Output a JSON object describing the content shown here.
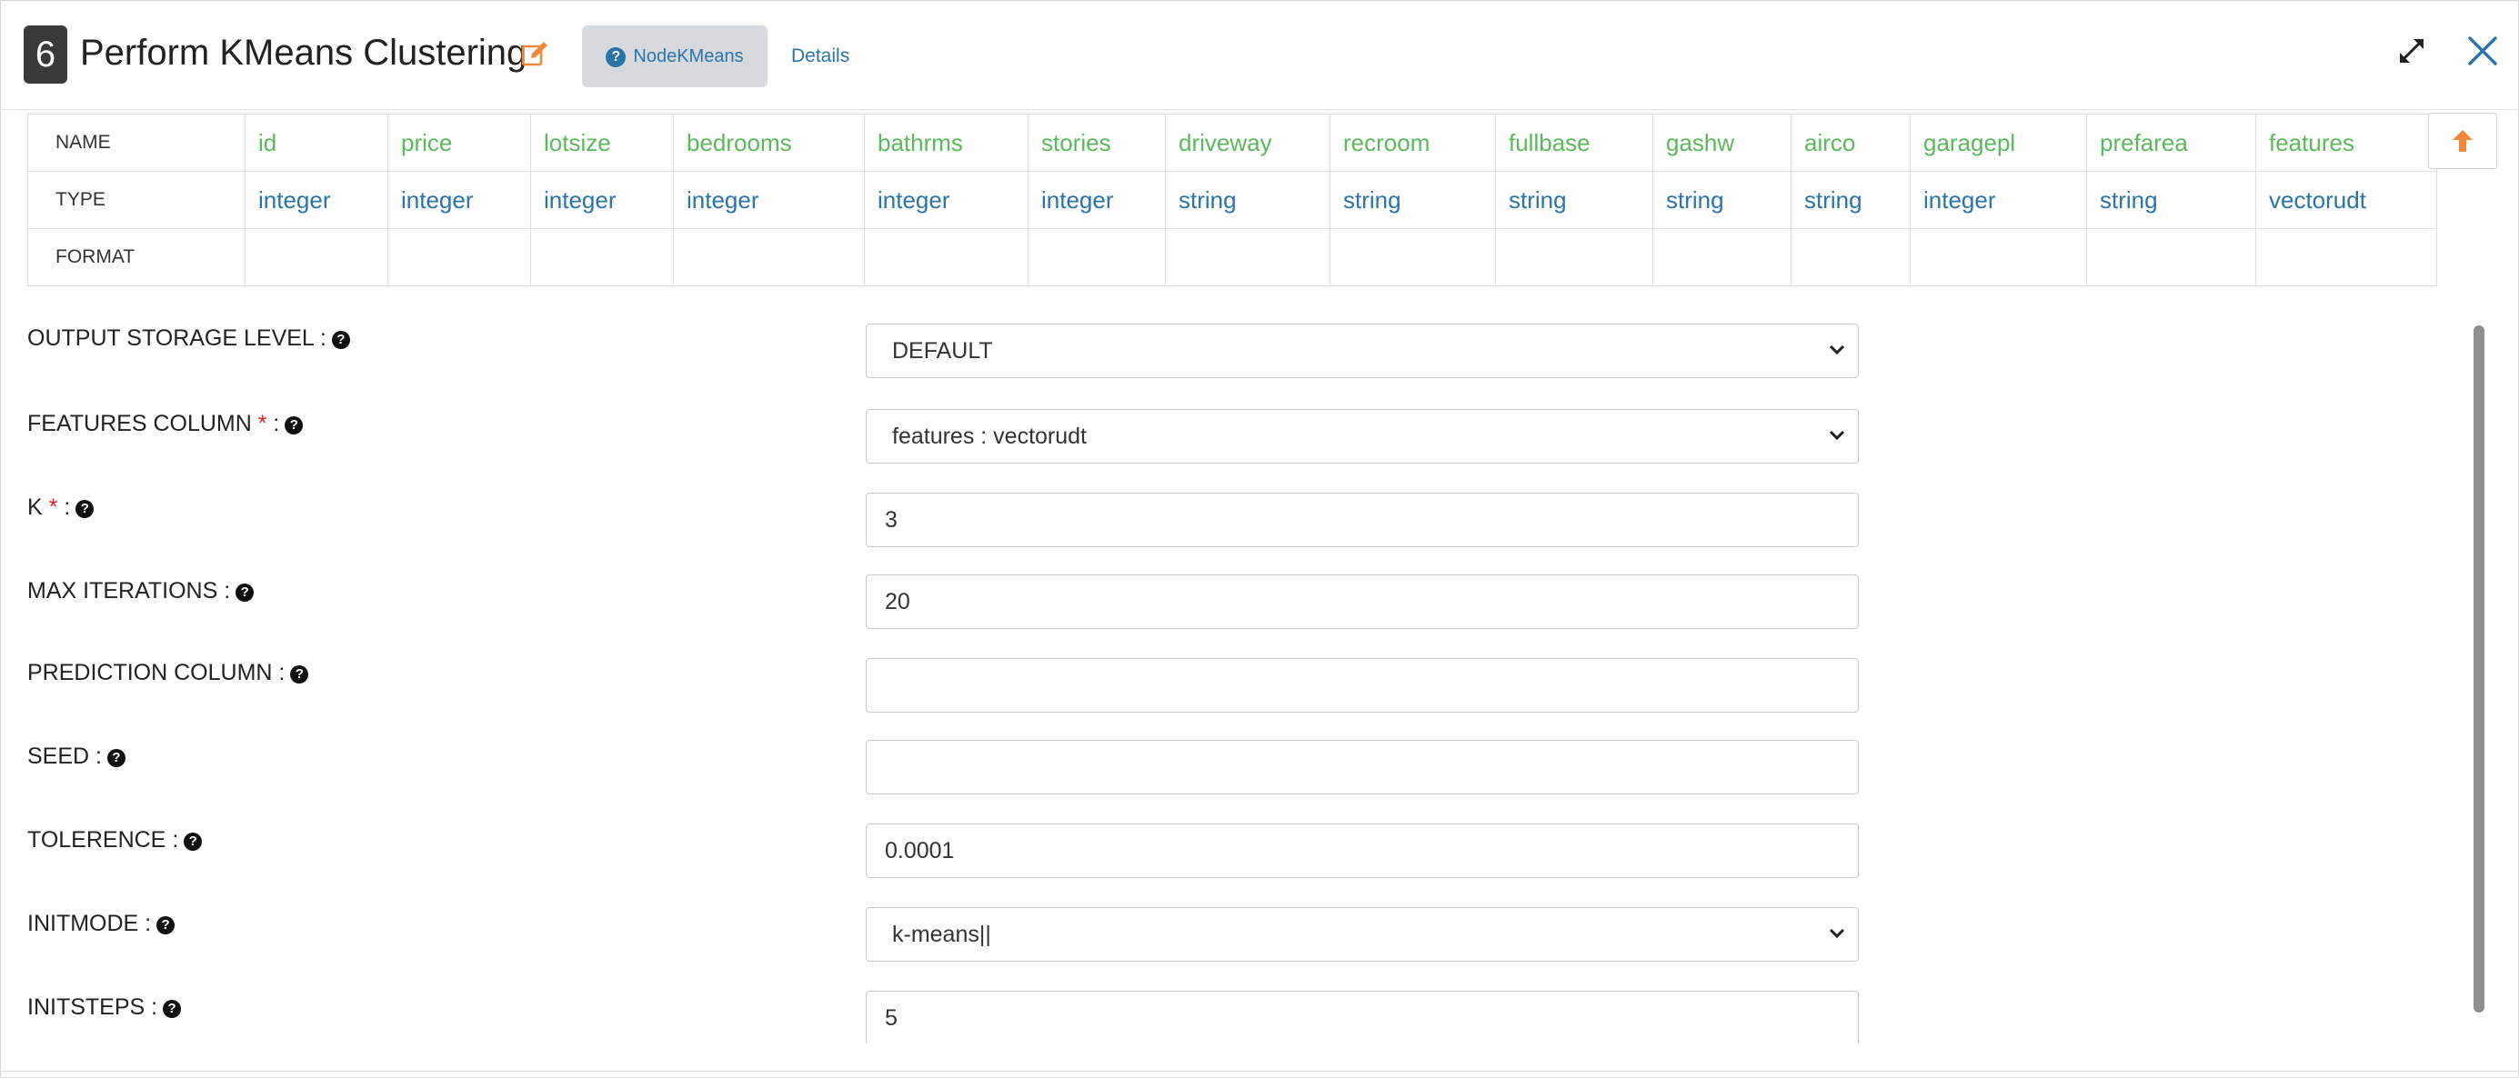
{
  "header": {
    "node_number": "6",
    "title": "Perform KMeans Clustering",
    "tab_help_label": "NodeKMeans",
    "tab_details_label": "Details",
    "accent_color": "#2b74a8",
    "edit_icon_color": "#f0883a"
  },
  "schema": {
    "row_labels": [
      "NAME",
      "TYPE",
      "FORMAT"
    ],
    "columns": [
      {
        "name": "id",
        "type": "integer",
        "format": ""
      },
      {
        "name": "price",
        "type": "integer",
        "format": ""
      },
      {
        "name": "lotsize",
        "type": "integer",
        "format": ""
      },
      {
        "name": "bedrooms",
        "type": "integer",
        "format": ""
      },
      {
        "name": "bathrms",
        "type": "integer",
        "format": ""
      },
      {
        "name": "stories",
        "type": "integer",
        "format": ""
      },
      {
        "name": "driveway",
        "type": "string",
        "format": ""
      },
      {
        "name": "recroom",
        "type": "string",
        "format": ""
      },
      {
        "name": "fullbase",
        "type": "string",
        "format": ""
      },
      {
        "name": "gashw",
        "type": "string",
        "format": ""
      },
      {
        "name": "airco",
        "type": "string",
        "format": ""
      },
      {
        "name": "garagepl",
        "type": "integer",
        "format": ""
      },
      {
        "name": "prefarea",
        "type": "string",
        "format": ""
      },
      {
        "name": "features",
        "type": "vectorudt",
        "format": ""
      }
    ],
    "name_color": "#5cb85c",
    "type_color": "#2b74a8"
  },
  "form": {
    "fields": [
      {
        "label": "OUTPUT STORAGE LEVEL",
        "required": false,
        "kind": "select",
        "value": "DEFAULT"
      },
      {
        "label": "FEATURES COLUMN",
        "required": true,
        "kind": "select",
        "value": "features : vectorudt"
      },
      {
        "label": "K",
        "required": true,
        "kind": "input",
        "value": "3"
      },
      {
        "label": "MAX ITERATIONS",
        "required": false,
        "kind": "input",
        "value": "20"
      },
      {
        "label": "PREDICTION COLUMN",
        "required": false,
        "kind": "input",
        "value": ""
      },
      {
        "label": "SEED",
        "required": false,
        "kind": "input",
        "value": ""
      },
      {
        "label": "TOLERENCE",
        "required": false,
        "kind": "input",
        "value": "0.0001"
      },
      {
        "label": "INITMODE",
        "required": false,
        "kind": "select",
        "value": "k-means||"
      },
      {
        "label": "INITSTEPS",
        "required": false,
        "kind": "input",
        "value": "5"
      }
    ],
    "required_marker": "*",
    "label_suffix": ":"
  },
  "icons": {
    "edit": "edit-icon",
    "help": "question-circle-icon",
    "expand": "expand-icon",
    "close": "close-icon",
    "scroll_up": "arrow-up-icon",
    "dropdown": "chevron-down-icon"
  }
}
